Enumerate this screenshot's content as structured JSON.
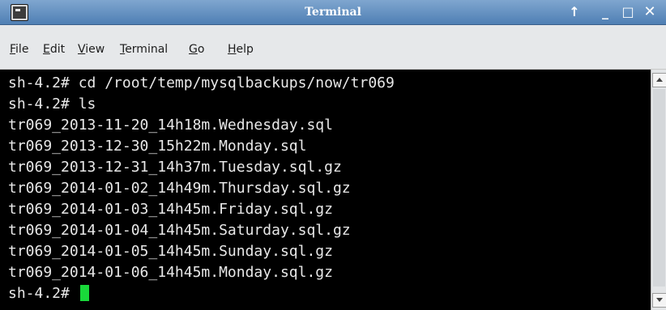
{
  "window": {
    "title": "Terminal",
    "controls": {
      "up": "↑",
      "minimize": "_",
      "maximize": "□",
      "close": "✕"
    }
  },
  "menu": {
    "items": [
      {
        "label_ul": "F",
        "label_rest": "ile"
      },
      {
        "label_ul": "E",
        "label_rest": "dit"
      },
      {
        "label_ul": "V",
        "label_rest": "iew"
      },
      {
        "label_ul": "T",
        "label_rest": "erminal"
      },
      {
        "label_ul": "G",
        "label_rest": "o"
      },
      {
        "label_ul": "H",
        "label_rest": "elp"
      }
    ]
  },
  "terminal": {
    "lines": [
      "sh-4.2# cd /root/temp/mysqlbackups/now/tr069",
      "sh-4.2# ls",
      "tr069_2013-11-20_14h18m.Wednesday.sql",
      "tr069_2013-12-30_15h22m.Monday.sql",
      "tr069_2013-12-31_14h37m.Tuesday.sql.gz",
      "tr069_2014-01-02_14h49m.Thursday.sql.gz",
      "tr069_2014-01-03_14h45m.Friday.sql.gz",
      "tr069_2014-01-04_14h45m.Saturday.sql.gz",
      "tr069_2014-01-05_14h45m.Sunday.sql.gz",
      "tr069_2014-01-06_14h45m.Monday.sql.gz"
    ],
    "prompt": "sh-4.2# ",
    "cursor_color": "#19d93a"
  },
  "colors": {
    "titlebar": "#5f8cbf",
    "terminal_bg": "#000000",
    "terminal_fg": "#e8e8e8"
  }
}
